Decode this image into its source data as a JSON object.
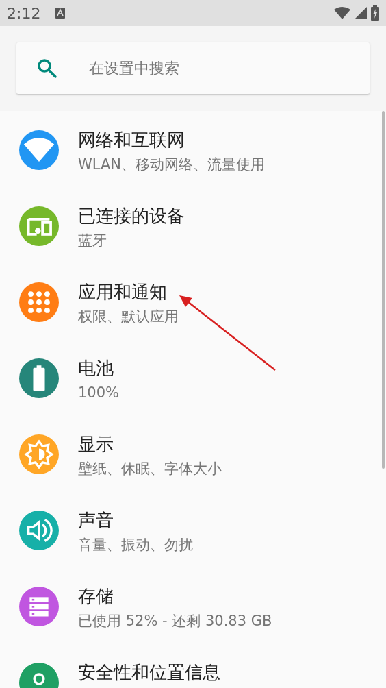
{
  "status_bar": {
    "time": "2:12"
  },
  "search": {
    "placeholder": "在设置中搜索"
  },
  "items": [
    {
      "title": "网络和互联网",
      "subtitle": "WLAN、移动网络、流量使用",
      "kind": "wifi",
      "color": "#2196f3"
    },
    {
      "title": "已连接的设备",
      "subtitle": "蓝牙",
      "kind": "devices",
      "color": "#76b82a"
    },
    {
      "title": "应用和通知",
      "subtitle": "权限、默认应用",
      "kind": "apps",
      "color": "#ff7d14"
    },
    {
      "title": "电池",
      "subtitle": "100%",
      "kind": "battery",
      "color": "#26867a"
    },
    {
      "title": "显示",
      "subtitle": "壁纸、休眠、字体大小",
      "kind": "display",
      "color": "#ffa626"
    },
    {
      "title": "声音",
      "subtitle": "音量、振动、勿扰",
      "kind": "sound",
      "color": "#17b0a8"
    },
    {
      "title": "存储",
      "subtitle": "已使用 52% - 还剩 30.83 GB",
      "kind": "storage",
      "color": "#c056e0"
    },
    {
      "title": "安全性和位置信息",
      "kind": "security",
      "color": "#1fa064"
    }
  ]
}
